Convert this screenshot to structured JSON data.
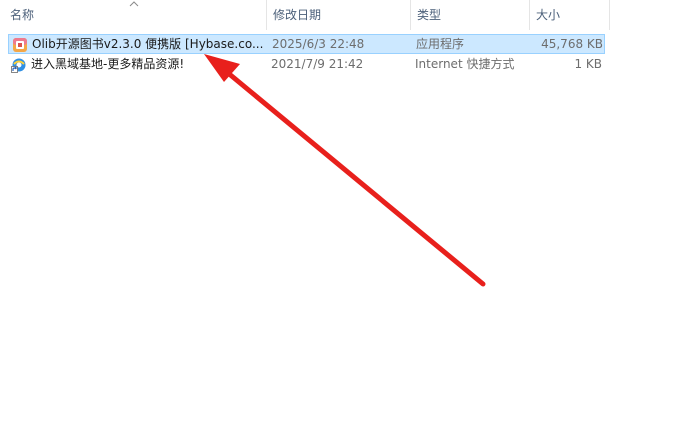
{
  "columns": {
    "name": "名称",
    "date": "修改日期",
    "type": "类型",
    "size": "大小"
  },
  "files": [
    {
      "name": "Olib开源图书v2.3.0 便携版 [Hybase.co...",
      "date": "2025/6/3 22:48",
      "type": "应用程序",
      "size": "45,768 KB",
      "icon": "app-icon",
      "selected": true
    },
    {
      "name": "进入黑域基地-更多精品资源!",
      "date": "2021/7/9 21:42",
      "type": "Internet 快捷方式",
      "size": "1 KB",
      "icon": "internet-shortcut-icon",
      "selected": false
    }
  ],
  "colors": {
    "selection_bg": "#cce8ff",
    "selection_border": "#99d1ff",
    "header_text": "#4c607a",
    "annotation_arrow": "#e8201c"
  }
}
